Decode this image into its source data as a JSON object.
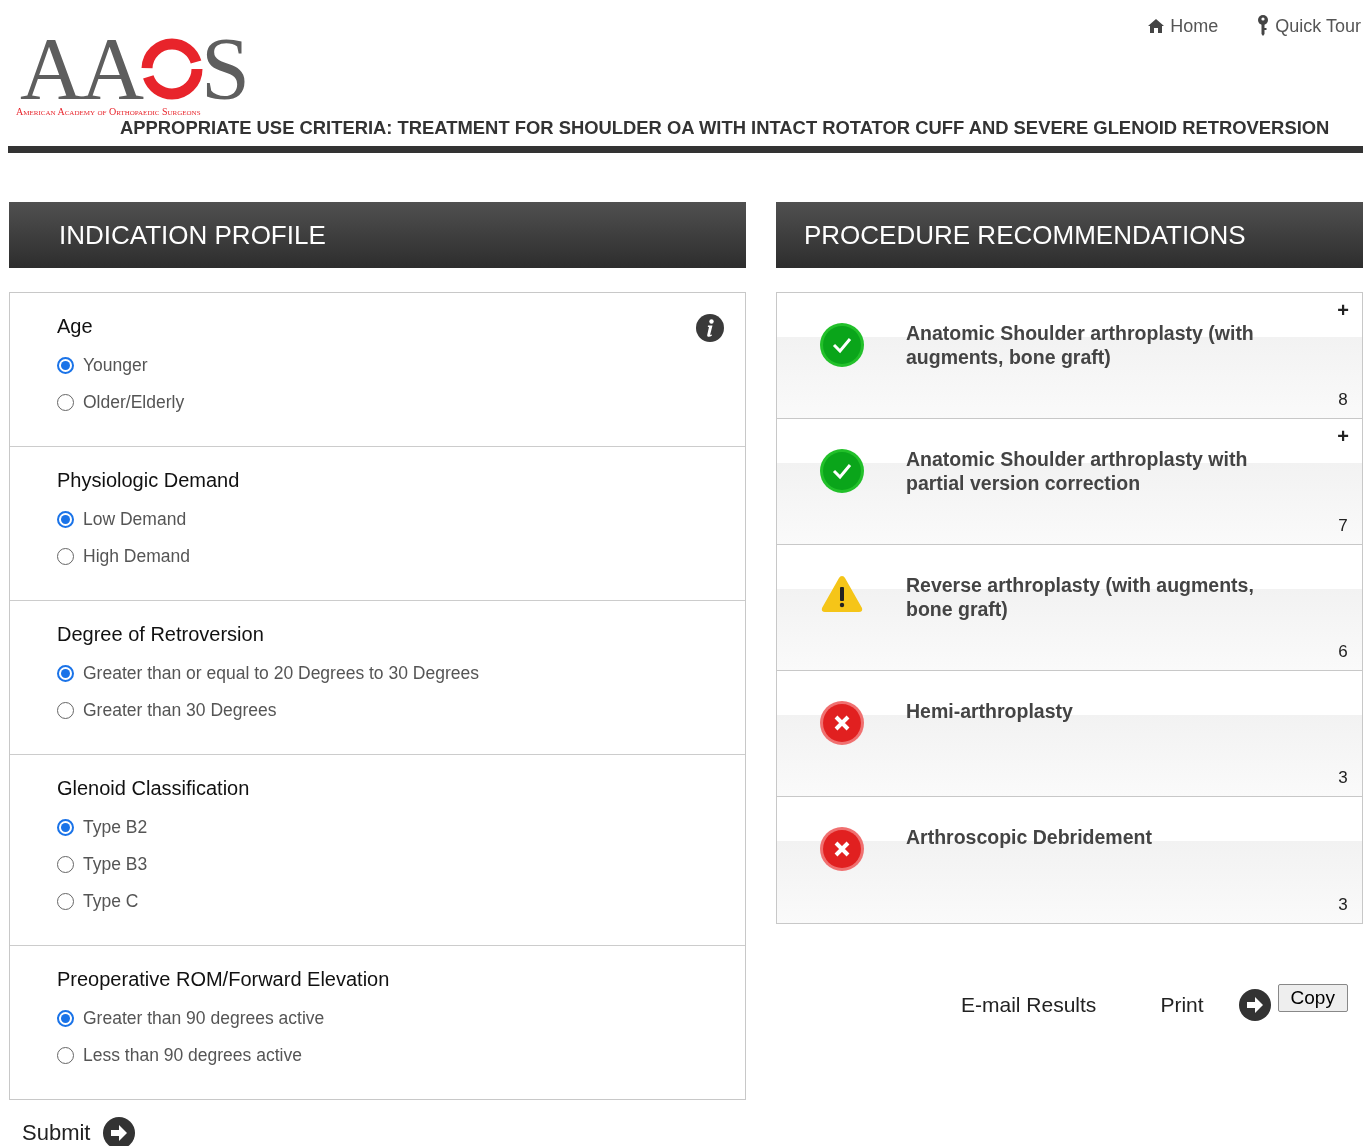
{
  "top_nav": [
    {
      "kind": "home",
      "label": "Home"
    },
    {
      "kind": "key",
      "label": "Quick Tour"
    }
  ],
  "logo": {
    "left": "AA",
    "right": "S",
    "tagline": "American Academy of Orthopaedic Surgeons"
  },
  "page_title": "APPROPRIATE USE CRITERIA: TREATMENT FOR SHOULDER OA WITH INTACT ROTATOR CUFF AND SEVERE GLENOID RETROVERSION",
  "indication_profile": {
    "title": "INDICATION PROFILE",
    "sections": [
      {
        "label": "Age",
        "info": true,
        "options": [
          {
            "label": "Younger",
            "selected": true
          },
          {
            "label": "Older/Elderly",
            "selected": false
          }
        ]
      },
      {
        "label": "Physiologic Demand",
        "info": false,
        "options": [
          {
            "label": "Low Demand",
            "selected": true
          },
          {
            "label": "High Demand",
            "selected": false
          }
        ]
      },
      {
        "label": "Degree of Retroversion",
        "info": false,
        "options": [
          {
            "label": "Greater than or equal to 20 Degrees to 30 Degrees",
            "selected": true
          },
          {
            "label": "Greater than 30 Degrees",
            "selected": false
          }
        ]
      },
      {
        "label": "Glenoid Classification",
        "info": false,
        "options": [
          {
            "label": "Type B2",
            "selected": true
          },
          {
            "label": "Type B3",
            "selected": false
          },
          {
            "label": "Type C",
            "selected": false
          }
        ]
      },
      {
        "label": "Preoperative ROM/Forward Elevation",
        "info": false,
        "options": [
          {
            "label": "Greater than 90 degrees active",
            "selected": true
          },
          {
            "label": "Less than 90 degrees active",
            "selected": false
          }
        ]
      }
    ],
    "submit": "Submit"
  },
  "procedure_recommendations": {
    "title": "PROCEDURE RECOMMENDATIONS",
    "items": [
      {
        "kind": "appropriate",
        "name": "Anatomic Shoulder arthroplasty (with augments, bone graft)",
        "score": "8",
        "expand": "+"
      },
      {
        "kind": "appropriate",
        "name": "Anatomic Shoulder arthroplasty with partial version correction",
        "score": "7",
        "expand": "+"
      },
      {
        "kind": "may_be_appropriate",
        "name": "Reverse arthroplasty (with augments, bone graft)",
        "score": "6"
      },
      {
        "kind": "rarely_appropriate",
        "name": "Hemi-arthroplasty",
        "score": "3"
      },
      {
        "kind": "rarely_appropriate",
        "name": "Arthroscopic Debridement",
        "score": "3"
      }
    ]
  },
  "actions": {
    "email": "E-mail Results",
    "print": "Print",
    "copy": "Copy"
  }
}
